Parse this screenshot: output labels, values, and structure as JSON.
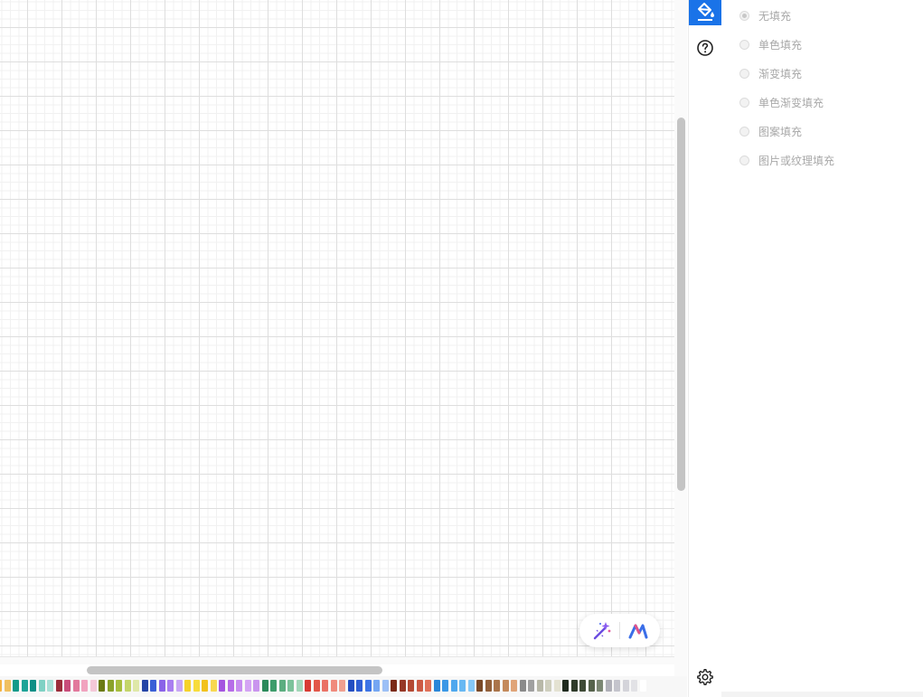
{
  "fill_panel": {
    "options": [
      {
        "label": "无填充",
        "selected": true
      },
      {
        "label": "单色填充",
        "selected": false
      },
      {
        "label": "渐变填充",
        "selected": false
      },
      {
        "label": "单色渐变填充",
        "selected": false
      },
      {
        "label": "图案填充",
        "selected": false
      },
      {
        "label": "图片或纹理填充",
        "selected": false
      }
    ]
  },
  "tool_strip": {
    "active_tool": "fill-bucket-icon",
    "icons": [
      "fill-bucket-icon",
      "help-circle-icon",
      "settings-gear-icon"
    ],
    "accent_color": "#1a73e8"
  },
  "ai_toolbar": {
    "icons": [
      "magic-wand-icon",
      "ai-logo-icon"
    ]
  },
  "palette": {
    "colors": [
      "#f5b342",
      "#f0c060",
      "#139a8a",
      "#1ea397",
      "#0f8f86",
      "#7fd1c4",
      "#a8e0d6",
      "#9b2d3a",
      "#c94d7a",
      "#e2799c",
      "#f1a3bf",
      "#f4c8d8",
      "#6b7a16",
      "#8aa22a",
      "#a6bd3c",
      "#c4d56a",
      "#dfe8a8",
      "#2444a6",
      "#3a5fd6",
      "#8a63e8",
      "#a97ef0",
      "#c8a6f5",
      "#f5d22a",
      "#f7dc3c",
      "#f2c21e",
      "#f8d850",
      "#a455e0",
      "#b66ce8",
      "#c78cf0",
      "#d4a4f4",
      "#c995ee",
      "#2a8a5a",
      "#3f9c6c",
      "#5cae80",
      "#7cc29a",
      "#a2d6b8",
      "#d83a32",
      "#e2574a",
      "#ea7266",
      "#f08a7c",
      "#f0a090",
      "#234ec2",
      "#2f5ed4",
      "#3d74e6",
      "#75a6f2",
      "#9cc0f6",
      "#7a2a18",
      "#963826",
      "#b44a34",
      "#cc5a44",
      "#e07058",
      "#2a86d8",
      "#3a98e6",
      "#4fa8ee",
      "#68b8f2",
      "#86c8f6",
      "#7a4a28",
      "#92603a",
      "#aa744a",
      "#c48a5c",
      "#e0a478",
      "#8a8a8a",
      "#a0a0a0",
      "#b8b8a8",
      "#cfcfbe",
      "#e4e2d2",
      "#1e2a1e",
      "#2e3a2a",
      "#3e4a36",
      "#56634c",
      "#7a8672",
      "#b0b0b8",
      "#c4c4cc",
      "#d4d4da",
      "#e2e2e6",
      "#ffffff"
    ]
  }
}
